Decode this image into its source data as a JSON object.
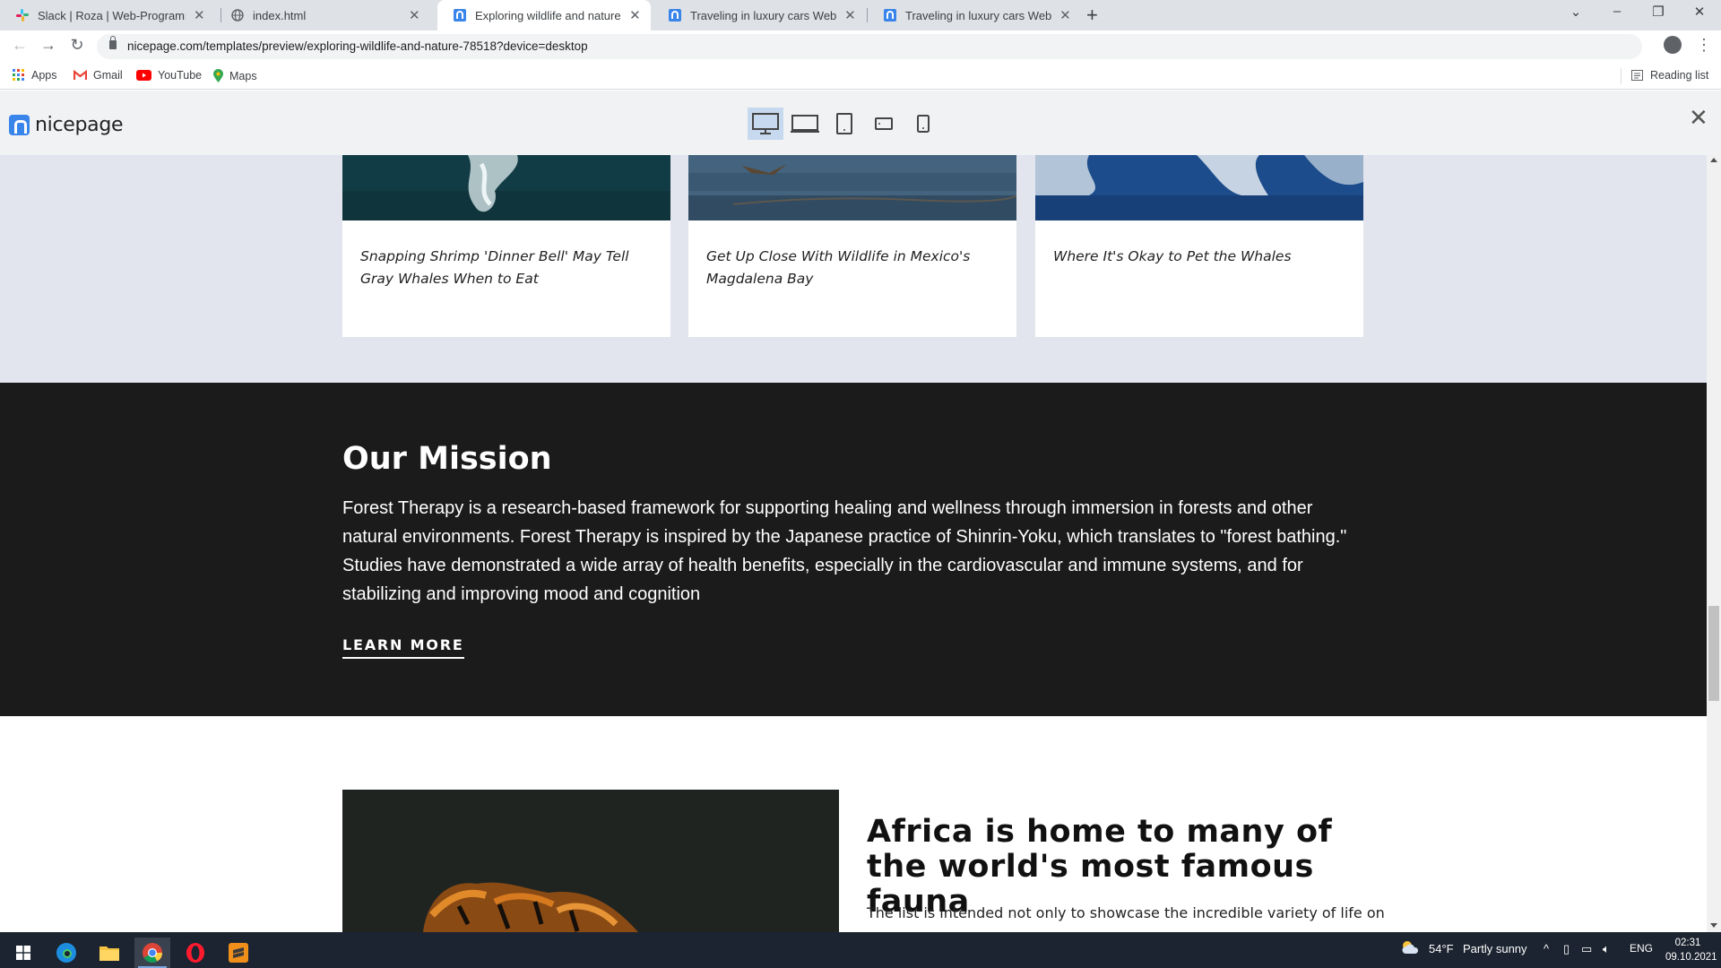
{
  "browser": {
    "tabs": [
      {
        "title": "Slack | Roza | Web-Programming",
        "icon": "slack-icon",
        "active": false
      },
      {
        "title": "index.html",
        "icon": "globe-icon",
        "active": false
      },
      {
        "title": "Exploring wildlife and nature Tem",
        "icon": "nicepage-icon",
        "active": true
      },
      {
        "title": "Traveling in luxury cars Web Page",
        "icon": "nicepage-icon",
        "active": false
      },
      {
        "title": "Traveling in luxury cars Web Page",
        "icon": "nicepage-icon",
        "active": false
      }
    ],
    "url": "nicepage.com/templates/preview/exploring-wildlife-and-nature-78518?device=desktop",
    "bookmarks": [
      {
        "label": "Apps",
        "icon": "apps-grid-icon"
      },
      {
        "label": "Gmail",
        "icon": "gmail-icon"
      },
      {
        "label": "YouTube",
        "icon": "youtube-icon"
      },
      {
        "label": "Maps",
        "icon": "maps-pin-icon"
      }
    ],
    "reading_list": "Reading list"
  },
  "nicepage": {
    "logo": "nicepage",
    "devices": [
      "desktop",
      "laptop",
      "tablet",
      "tablet-landscape",
      "phone"
    ],
    "active_device": "desktop"
  },
  "news_cards": [
    {
      "title": "Snapping Shrimp 'Dinner Bell' May Tell Gray Whales When to Eat"
    },
    {
      "title": "Get Up Close With Wildlife in Mexico's Magdalena Bay"
    },
    {
      "title": "Where It's Okay to Pet the Whales"
    }
  ],
  "mission": {
    "title": "Our Mission",
    "text": "Forest Therapy is a research-based framework for supporting healing and wellness through immersion in forests and other natural environments. Forest Therapy is inspired by the Japanese practice of Shinrin-Yoku, which translates to \"forest bathing.\" Studies have demonstrated a wide array of health benefits, especially in the cardiovascular and immune systems, and for stabilizing and improving mood and cognition",
    "cta": "LEARN MORE"
  },
  "africa": {
    "title": "Africa is home to many of the world's most famous fauna",
    "text": "The list is intended not only to showcase the incredible variety of life on"
  },
  "taskbar": {
    "weather_temp": "54°F",
    "weather_desc": "Partly sunny",
    "language": "ENG",
    "time": "02:31",
    "date": "09.10.2021"
  },
  "colors": {
    "mission_bg": "#1b1b1b",
    "news_bg": "#e2e5ed",
    "nicepage_blue": "#3a85ea",
    "taskbar_bg": "#1c2431"
  }
}
